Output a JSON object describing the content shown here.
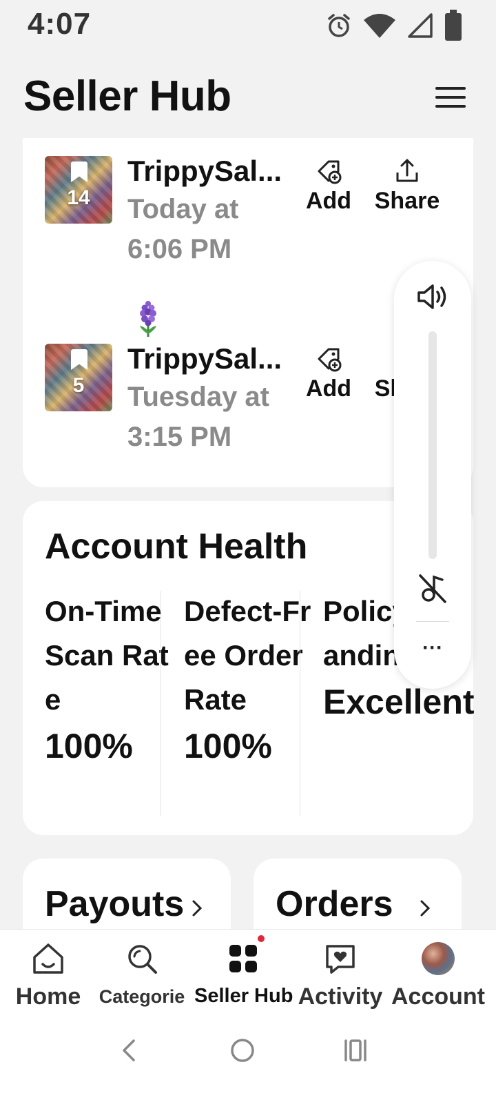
{
  "status_bar": {
    "time": "4:07",
    "icons": [
      "alarm-icon",
      "wifi-icon",
      "signal-icon",
      "battery-icon"
    ]
  },
  "header": {
    "title": "Seller Hub",
    "menu_icon": "hamburger-menu-icon"
  },
  "listings": [
    {
      "name": "TrippySal...",
      "date": "Today at 6:06 PM",
      "photo_count": "14",
      "add_label": "Add",
      "share_label": "Share"
    },
    {
      "name": "TrippySal...",
      "date": "Tuesday at 3:15 PM",
      "photo_count": "5",
      "add_label": "Add",
      "share_label": "Share"
    }
  ],
  "account_health": {
    "title": "Account Health",
    "metrics": [
      {
        "label": "On-Time Scan Rate",
        "value": "100%"
      },
      {
        "label": "Defect-Free Order Rate",
        "value": "100%"
      },
      {
        "label": "Policy Standing",
        "value": "Excellent"
      }
    ]
  },
  "cards": {
    "payouts": "Payouts",
    "orders": "Orders"
  },
  "bottom_nav": {
    "items": [
      {
        "label": "Home",
        "icon": "home-icon"
      },
      {
        "label": "Categorie",
        "icon": "search-icon"
      },
      {
        "label": "Seller Hub",
        "icon": "grid-icon"
      },
      {
        "label": "Activity",
        "icon": "heart-chat-icon"
      },
      {
        "label": "Account",
        "icon": "avatar"
      }
    ],
    "active": "Seller Hub"
  },
  "volume_panel": {
    "icons": [
      "speaker-icon",
      "muted-vibrate-icon",
      "more-icon"
    ],
    "more_label": "···"
  },
  "colors": {
    "background": "#f2f2f2",
    "card": "#ffffff",
    "muted_text": "#8a8a8a",
    "badge": "#e0283c"
  }
}
